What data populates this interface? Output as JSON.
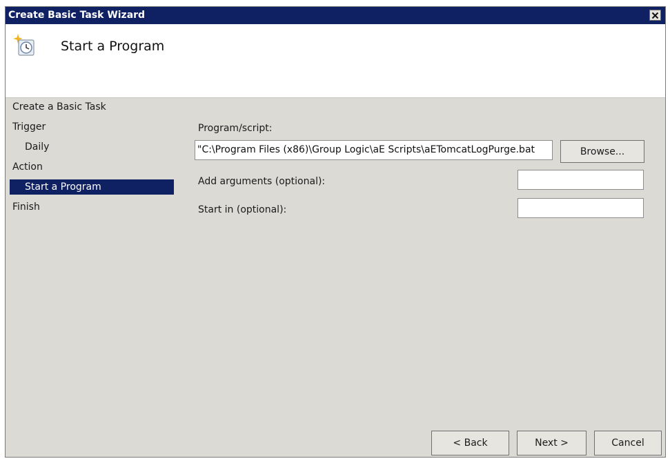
{
  "window": {
    "title": "Create Basic Task Wizard",
    "close_symbol": "✕"
  },
  "header": {
    "icon": "task-scheduler-clock-icon",
    "title": "Start a Program"
  },
  "nav": {
    "items": [
      {
        "label": "Create a Basic Task"
      },
      {
        "label": "Trigger"
      },
      {
        "label": "Daily"
      },
      {
        "label": "Action"
      },
      {
        "label": "Start a Program",
        "selected": true
      },
      {
        "label": "Finish"
      }
    ]
  },
  "form": {
    "program_label": "Program/script:",
    "program_value": "\"C:\\Program Files (x86)\\Group Logic\\aE Scripts\\aETomcatLogPurge.bat",
    "browse_label": "Browse...",
    "arguments_label": "Add arguments (optional):",
    "arguments_value": "",
    "start_in_label": "Start in (optional):",
    "start_in_value": ""
  },
  "footer": {
    "back_label": "< Back",
    "next_label": "Next >",
    "cancel_label": "Cancel"
  },
  "colors": {
    "titlebar": "#0f2162",
    "selection": "#0f2162",
    "dialog_bg": "#dcdad5"
  }
}
